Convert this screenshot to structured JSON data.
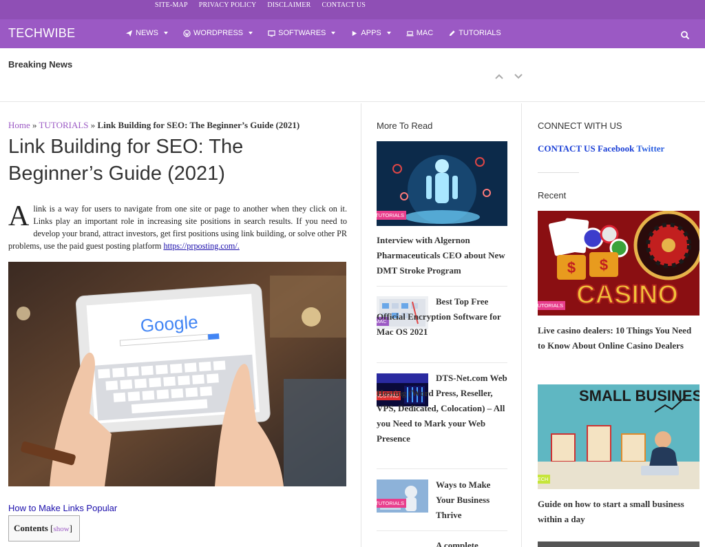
{
  "topbar": {
    "links": [
      "SITE-MAP",
      "PRIVACY POLICY",
      "DISCLAIMER",
      "CONTACT US"
    ]
  },
  "nav": {
    "brand": "TECHWIBE",
    "items": [
      {
        "label": "NEWS",
        "icon": "paper-plane-icon",
        "dropdown": true
      },
      {
        "label": "WORDPRESS",
        "icon": "wordpress-icon",
        "dropdown": true
      },
      {
        "label": "SOFTWARES",
        "icon": "monitor-icon",
        "dropdown": true
      },
      {
        "label": "APPS",
        "icon": "play-icon",
        "dropdown": true
      },
      {
        "label": "MAC",
        "icon": "laptop-icon",
        "dropdown": false
      },
      {
        "label": "TUTORIALS",
        "icon": "pencil-icon",
        "dropdown": false
      }
    ],
    "search_icon": "search-icon"
  },
  "breaking": {
    "label": "Breaking News"
  },
  "article": {
    "breadcrumb": {
      "home": "Home",
      "sep": "»",
      "category": "TUTORIALS",
      "current": "Link Building for SEO: The Beginner’s Guide (2021)"
    },
    "title": "Link Building for SEO: The Beginner’s Guide (2021)",
    "dropcap": "A",
    "intro": "link is a way for users to navigate from one site or page to another when they click on it. Links play an important role in increasing site positions in search results. If you need to develop your brand, attract investors, get first positions using link building, or solve other PR problems, use the paid guest posting platform ",
    "intro_link": "https://prposting.com/.",
    "hero_text": "Google",
    "toc_link": "How to Make Links Popular",
    "contents_label": "Contents",
    "contents_show": "show"
  },
  "more_to_read": {
    "heading": "More To Read",
    "featured": {
      "tag": "TUTORIALS",
      "title": "Interview with Algernon Pharmaceuticals CEO about New DMT Stroke Program"
    },
    "items": [
      {
        "tag": "MAC",
        "title": "Best Top Free Official Encryption Software for Mac OS 2021"
      },
      {
        "tag": "HOSTING",
        "title": "DTS-Net.com Web Hosting (Word Press, Reseller, VPS, Dedicated, Colocation) – All you Need to Mark your Web Presence"
      },
      {
        "tag": "TUTORIALS",
        "title": "Ways to Make Your Business Thrive"
      },
      {
        "tag": "",
        "title": "A complete"
      }
    ]
  },
  "sidebar": {
    "connect_heading": "CONNECT WITH US",
    "connect_links": [
      "CONTACT US",
      "Facebook",
      "Twitter"
    ],
    "recent_heading": "Recent",
    "recent": [
      {
        "tag": "TUTORIALS",
        "image_text": "CASINO",
        "title": "Live casino dealers: 10 Things You Need to Know About Online Casino Dealers"
      },
      {
        "tag": "TECH",
        "image_text": "SMALL BUSINESS",
        "title": "Guide on how to start a small business within a day"
      }
    ]
  },
  "colors": {
    "nav": "#9b59c4",
    "topbar": "#8f4fb5",
    "tag_pink": "#e83e8c",
    "link": "#1a0dab"
  }
}
